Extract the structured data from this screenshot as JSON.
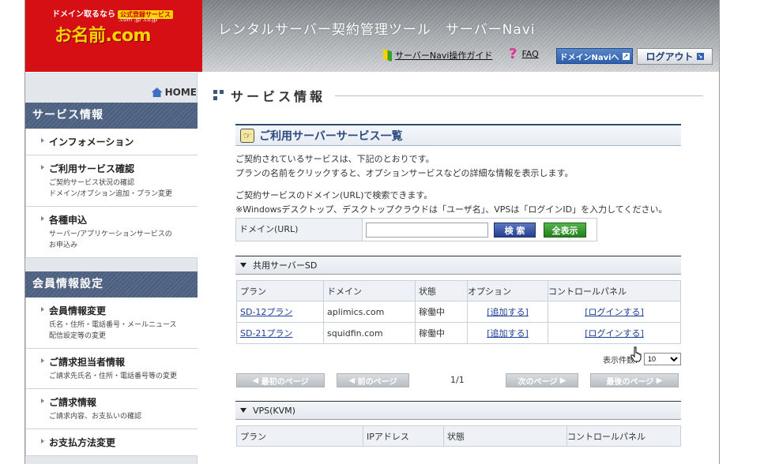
{
  "header": {
    "slogan": "ドメイン取るなら",
    "badge": "公式登録サービス",
    "tlds": ".com .jp .co.jp",
    "brand": "お名前.com",
    "title": "レンタルサーバー契約管理ツール　サーバーNavi",
    "guide_link": "サーバーNavi操作ガイド",
    "faq_link": "FAQ",
    "domain_navi_btn": "ドメインNaviへ",
    "logout_btn": "ログアウト"
  },
  "sidebar": {
    "home": "HOME",
    "sections": [
      {
        "title": "サービス情報",
        "items": [
          {
            "title": "インフォメーション",
            "desc": []
          },
          {
            "title": "ご利用サービス確認",
            "desc": [
              "ご契約サービス状況の確認",
              "ドメイン/オプション追加・プラン変更"
            ]
          },
          {
            "title": "各種申込",
            "desc": [
              "サーバー/アプリケーションサービスの",
              "お申込み"
            ]
          }
        ]
      },
      {
        "title": "会員情報設定",
        "items": [
          {
            "title": "会員情報変更",
            "desc": [
              "氏名・住所・電話番号・メールニュース",
              "配信設定等の変更"
            ]
          },
          {
            "title": "ご請求担当者情報",
            "desc": [
              "ご請求先氏名・住所・電話番号等の変更"
            ]
          },
          {
            "title": "ご請求情報",
            "desc": [
              "ご請求内容、お支払いの確認"
            ]
          },
          {
            "title": "お支払方法変更",
            "desc": []
          }
        ]
      }
    ]
  },
  "main": {
    "page_title": "サービス情報",
    "panel_title": "ご利用サーバーサービス一覧",
    "intro": [
      "ご契約されているサービスは、下記のとおりです。",
      "プランの名前をクリックすると、オプションサービスなどの詳細な情報を表示します。"
    ],
    "search_intro": [
      "ご契約サービスのドメイン(URL)で検索できます。",
      "※Windowsデスクトップ、デスクトップクラウドは「ユーザ名」、VPSは「ログインID」を入力してください。"
    ],
    "search_label": "ドメイン(URL)",
    "search_value": "",
    "search_btn": "検 索",
    "show_all_btn": "全表示",
    "shared": {
      "title": "共用サーバーSD",
      "headers": [
        "プラン",
        "ドメイン",
        "状態",
        "オプション",
        "コントロールパネル"
      ],
      "rows": [
        {
          "plan": "SD-12プラン",
          "domain": "aplimics.com",
          "status": "稼働中",
          "option": "[追加する]",
          "panel": "[ログインする]"
        },
        {
          "plan": "SD-21プラン",
          "domain": "squidfin.com",
          "status": "稼働中",
          "option": "[追加する]",
          "panel": "[ログインする]"
        }
      ],
      "perpage_label": "表示件数：",
      "perpage_value": "10",
      "pager": {
        "first": "最初のページ",
        "prev": "前のページ",
        "page": "1/1",
        "next": "次のページ",
        "last": "最後のページ"
      }
    },
    "vps": {
      "title": "VPS(KVM)",
      "headers": [
        "プラン",
        "IPアドレス",
        "状態",
        "コントロールパネル"
      ]
    }
  },
  "colors": {
    "brand_red": "#d50f14",
    "brand_yellow": "#ffd200",
    "navy": "#2e4a70",
    "link": "#1d3f9b",
    "search_btn": "#263f8f",
    "show_all_btn": "#23801d"
  }
}
